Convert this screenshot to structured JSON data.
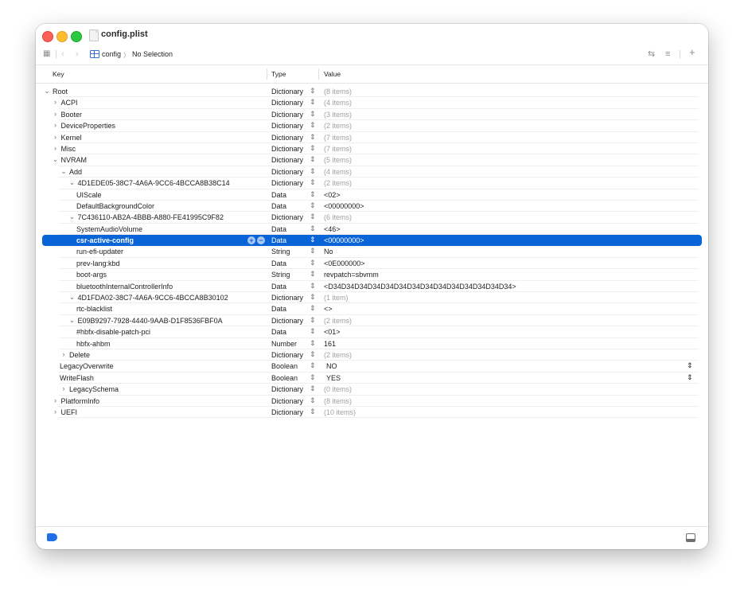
{
  "window": {
    "title": "config.plist"
  },
  "toolbar": {
    "grid_icon": "grid-icon",
    "back_icon": "chevron-left-icon",
    "forward_icon": "chevron-right-icon",
    "breadcrumb_root": "config",
    "breadcrumb_sep": "〉",
    "breadcrumb_current": "No Selection",
    "swap_icon": "swap-arrows-icon",
    "lines_icon": "text-lines-icon",
    "add_icon": "plus-icon"
  },
  "columns": {
    "key": "Key",
    "type": "Type",
    "value": "Value"
  },
  "colors": {
    "selection": "#0964d8",
    "muted": "#a1a1a6",
    "accent": "#1f6fe5"
  },
  "rows": [
    {
      "key": "Root",
      "type": "Dictionary",
      "value": "(8 items)",
      "chev": "⌄",
      "level": 0,
      "muted": true
    },
    {
      "key": "ACPI",
      "type": "Dictionary",
      "value": "(4 items)",
      "chev": "›",
      "level": 1,
      "muted": true
    },
    {
      "key": "Booter",
      "type": "Dictionary",
      "value": "(3 items)",
      "chev": "›",
      "level": 1,
      "muted": true
    },
    {
      "key": "DeviceProperties",
      "type": "Dictionary",
      "value": "(2 items)",
      "chev": "›",
      "level": 1,
      "muted": true
    },
    {
      "key": "Kernel",
      "type": "Dictionary",
      "value": "(7 items)",
      "chev": "›",
      "level": 1,
      "muted": true
    },
    {
      "key": "Misc",
      "type": "Dictionary",
      "value": "(7 items)",
      "chev": "›",
      "level": 1,
      "muted": true
    },
    {
      "key": "NVRAM",
      "type": "Dictionary",
      "value": "(5 items)",
      "chev": "⌄",
      "level": 1,
      "muted": true
    },
    {
      "key": "Add",
      "type": "Dictionary",
      "value": "(4 items)",
      "chev": "⌄",
      "level": 2,
      "muted": true
    },
    {
      "key": "4D1EDE05-38C7-4A6A-9CC6-4BCCA8B38C14",
      "type": "Dictionary",
      "value": "(2 items)",
      "chev": "⌄",
      "level": 3,
      "muted": true
    },
    {
      "key": "UIScale",
      "type": "Data",
      "value": "<02>",
      "chev": "",
      "level": 4,
      "muted": false
    },
    {
      "key": "DefaultBackgroundColor",
      "type": "Data",
      "value": "<00000000>",
      "chev": "",
      "level": 4,
      "muted": false
    },
    {
      "key": "7C436110-AB2A-4BBB-A880-FE41995C9F82",
      "type": "Dictionary",
      "value": "(6 items)",
      "chev": "⌄",
      "level": 3,
      "muted": true
    },
    {
      "key": "SystemAudioVolume",
      "type": "Data",
      "value": "<46>",
      "chev": "",
      "level": 4,
      "muted": false
    },
    {
      "key": "csr-active-config",
      "type": "Data",
      "value": "<00000000>",
      "chev": "",
      "level": 4,
      "muted": false,
      "selected": true
    },
    {
      "key": "run-efi-updater",
      "type": "String",
      "value": "No",
      "chev": "",
      "level": 4,
      "muted": false
    },
    {
      "key": "prev-lang:kbd",
      "type": "Data",
      "value": "<0E000000>",
      "chev": "",
      "level": 4,
      "muted": false
    },
    {
      "key": "boot-args",
      "type": "String",
      "value": "revpatch=sbvmm",
      "chev": "",
      "level": 4,
      "muted": false
    },
    {
      "key": "bluetoothInternalControllerInfo",
      "type": "Data",
      "value": "<D34D34D34D34D34D34D34D34D34D34D34D34D34D34>",
      "chev": "",
      "level": 4,
      "muted": false
    },
    {
      "key": "4D1FDA02-38C7-4A6A-9CC6-4BCCA8B30102",
      "type": "Dictionary",
      "value": "(1 item)",
      "chev": "⌄",
      "level": 3,
      "muted": true
    },
    {
      "key": "rtc-blacklist",
      "type": "Data",
      "value": "<>",
      "chev": "",
      "level": 4,
      "muted": false
    },
    {
      "key": "E09B9297-7928-4440-9AAB-D1F8536FBF0A",
      "type": "Dictionary",
      "value": "(2 items)",
      "chev": "⌄",
      "level": 3,
      "muted": true
    },
    {
      "key": "#hbfx-disable-patch-pci",
      "type": "Data",
      "value": "<01>",
      "chev": "",
      "level": 4,
      "muted": false
    },
    {
      "key": "hbfx-ahbm",
      "type": "Number",
      "value": "161",
      "chev": "",
      "level": 4,
      "muted": false
    },
    {
      "key": "Delete",
      "type": "Dictionary",
      "value": "(2 items)",
      "chev": "›",
      "level": 2,
      "muted": true
    },
    {
      "key": "LegacyOverwrite",
      "type": "Boolean",
      "value": "NO",
      "chev": "",
      "level": 2,
      "muted": false,
      "dropdown": true
    },
    {
      "key": "WriteFlash",
      "type": "Boolean",
      "value": "YES",
      "chev": "",
      "level": 2,
      "muted": false,
      "dropdown": true
    },
    {
      "key": "LegacySchema",
      "type": "Dictionary",
      "value": "(0 items)",
      "chev": "›",
      "level": 2,
      "muted": true
    },
    {
      "key": "PlatformInfo",
      "type": "Dictionary",
      "value": "(8 items)",
      "chev": "›",
      "level": 1,
      "muted": true
    },
    {
      "key": "UEFI",
      "type": "Dictionary",
      "value": "(10 items)",
      "chev": "›",
      "level": 1,
      "muted": true
    }
  ],
  "row_controls": {
    "add": "+",
    "remove": "−",
    "updown": "⇕",
    "dropdown": "⌃⌄"
  },
  "footer": {
    "tag_icon": "tag-icon",
    "panel_icon": "bottom-panel-icon"
  }
}
